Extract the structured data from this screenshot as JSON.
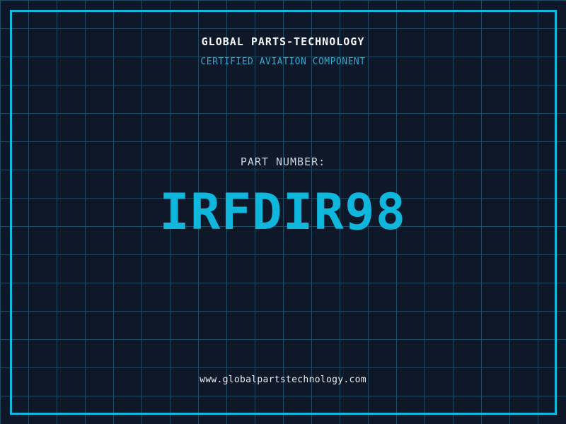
{
  "header": {
    "title": "GLOBAL PARTS-TECHNOLOGY",
    "subtitle": "CERTIFIED AVIATION COMPONENT"
  },
  "part": {
    "label": "PART NUMBER:",
    "number": "IRFDIR98"
  },
  "footer": {
    "website": "www.globalpartstechnology.com"
  },
  "colors": {
    "background": "#0e1828",
    "grid_line": "#1d4c62",
    "frame_cyan": "#15b8dc",
    "part_number_cyan": "#10b7dd",
    "subtitle_cyan": "#2fa9ce",
    "title_white": "#f4f6f8",
    "label_gray": "#ccd4dc",
    "url_white": "#e9eef2"
  }
}
